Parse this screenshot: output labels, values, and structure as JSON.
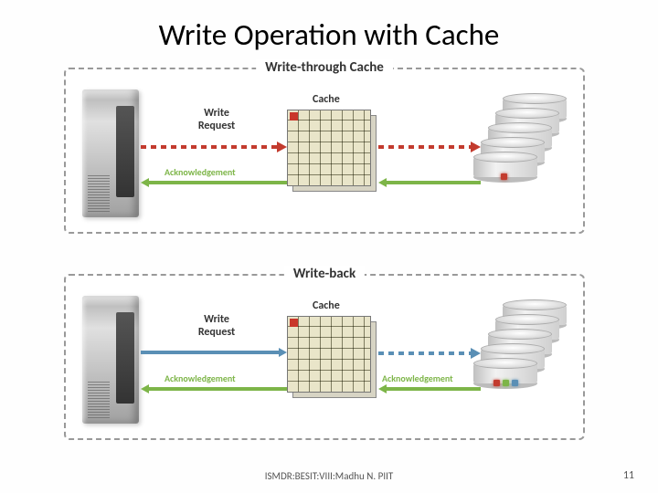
{
  "title": "Write Operation with Cache",
  "panels": {
    "a": {
      "title": "Write-through Cache",
      "cache_label": "Cache",
      "request_label": "Write\nRequest",
      "ack_label": "Acknowledgement"
    },
    "b": {
      "title": "Write-back",
      "cache_label": "Cache",
      "request_label": "Write\nRequest",
      "ack_left": "Acknowledgement",
      "ack_right": "Acknowledgement"
    }
  },
  "colors": {
    "request": "#c33b2e",
    "ack": "#7db548",
    "writeback_req": "#5a8fb5"
  },
  "disk_leds": {
    "a": [
      "#c33b2e"
    ],
    "b": [
      "#c33b2e",
      "#7db548",
      "#5a8fb5"
    ]
  },
  "footer": "ISMDR:BESIT:VIII:Madhu N. PIIT",
  "page": "11"
}
